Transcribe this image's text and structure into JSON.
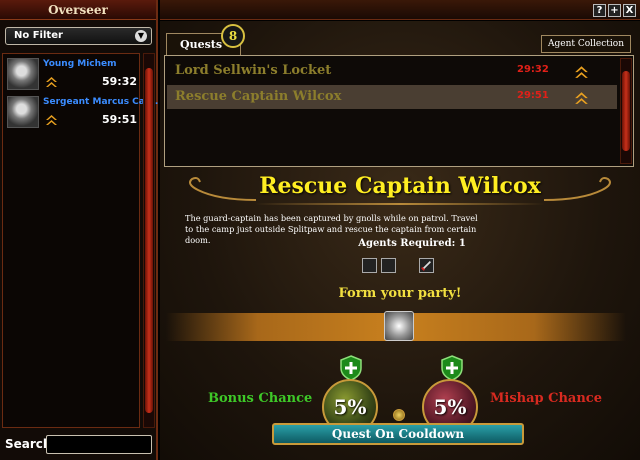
{
  "left_panel": {
    "title": "Overseer",
    "filter": {
      "value": "No Filter"
    },
    "agents": [
      {
        "name": "Young Michem",
        "time": "59:32"
      },
      {
        "name": "Sergeant Marcus Car...",
        "time": "59:51"
      }
    ],
    "search": {
      "label": "Search",
      "value": ""
    }
  },
  "window_buttons": [
    "?",
    "+",
    "X"
  ],
  "tabs": {
    "quests_label": "Quests",
    "quests_count": "8",
    "agent_collection_label": "Agent Collection"
  },
  "quests": [
    {
      "name": "Lord Sellwin's Locket",
      "time": "29:32",
      "selected": false
    },
    {
      "name": "Rescue Captain Wilcox",
      "time": "29:51",
      "selected": true
    }
  ],
  "detail": {
    "title": "Rescue Captain Wilcox",
    "description": "The guard-captain has been captured by gnolls while on patrol. Travel to the camp just outside Splitpaw and rescue the captain from certain doom.",
    "agents_required_label": "Agents Required:",
    "agents_required_value": "1",
    "party_label": "Form your party!",
    "bonus_label": "Bonus Chance",
    "bonus_value": "5%",
    "mishap_label": "Mishap Chance",
    "mishap_value": "5%",
    "action_button": "Quest On Cooldown"
  },
  "colors": {
    "quest_name": "#8c7e2c",
    "timer_red": "#e02018",
    "title_yellow": "#ffee22",
    "bonus_green": "#3ec828",
    "mishap_red": "#d82a20",
    "agent_blue": "#3b8cff"
  }
}
